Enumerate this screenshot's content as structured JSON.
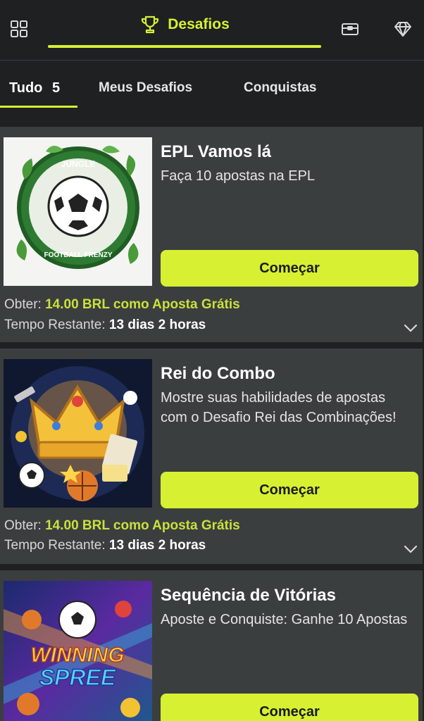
{
  "header": {
    "active_tab": "Desafios",
    "accent": "#d7f032"
  },
  "subtabs": {
    "all_label": "Tudo",
    "all_count": "5",
    "mine_label": "Meus Desafios",
    "achievements_label": "Conquistas"
  },
  "cards": [
    {
      "title": "EPL Vamos lá",
      "desc": "Faça 10 apostas na EPL",
      "button": "Começar",
      "reward_label": "Obter:",
      "reward_value": "14.00 BRL como Aposta Grátis",
      "time_label": "Tempo Restante:",
      "time_value": "13 dias 2 horas",
      "image_text_top": "JUNGLE",
      "image_text_bottom": "FOOTBALL FRENZY"
    },
    {
      "title": "Rei do Combo",
      "desc": "Mostre suas habilidades de apostas com o Desafio Rei das Combinações!",
      "button": "Começar",
      "reward_label": "Obter:",
      "reward_value": "14.00 BRL como Aposta Grátis",
      "time_label": "Tempo Restante:",
      "time_value": "13 dias 2 horas"
    },
    {
      "title": "Sequência de Vitórias",
      "desc": "Aposte e Conquiste: Ganhe 10 Apostas",
      "button": "Começar",
      "image_text_top": "WINNING",
      "image_text_bottom": "SPREE"
    }
  ]
}
